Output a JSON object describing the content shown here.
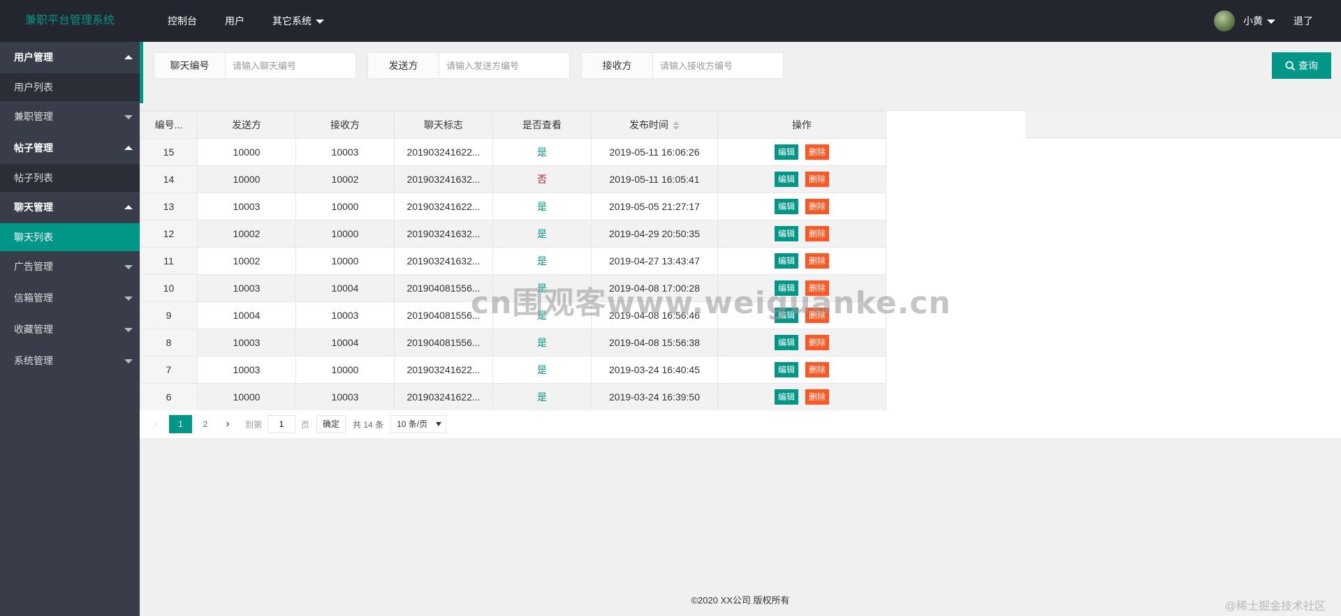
{
  "header": {
    "logo": "兼职平台管理系统",
    "nav": [
      "控制台",
      "用户",
      "其它系统"
    ],
    "user_name": "小黄",
    "logout": "退了"
  },
  "sidebar": {
    "groups": [
      {
        "label": "用户管理",
        "open": true,
        "subs": [
          "用户列表"
        ]
      },
      {
        "label": "兼职管理",
        "open": false,
        "subs": []
      },
      {
        "label": "帖子管理",
        "open": true,
        "subs": [
          "帖子列表"
        ]
      },
      {
        "label": "聊天管理",
        "open": true,
        "subs": [
          "聊天列表"
        ]
      },
      {
        "label": "广告管理",
        "open": false,
        "subs": []
      },
      {
        "label": "信箱管理",
        "open": false,
        "subs": []
      },
      {
        "label": "收藏管理",
        "open": false,
        "subs": []
      },
      {
        "label": "系统管理",
        "open": false,
        "subs": []
      }
    ],
    "active_sub": "聊天列表"
  },
  "search": {
    "chat_id_label": "聊天编号",
    "chat_id_placeholder": "请输入聊天编号",
    "sender_label": "发送方",
    "sender_placeholder": "请输入发送方编号",
    "receiver_label": "接收方",
    "receiver_placeholder": "请输入接收方编号",
    "query_button": "查询"
  },
  "table": {
    "columns": [
      "编号...",
      "发送方",
      "接收方",
      "聊天标志",
      "是否查看",
      "发布时间",
      "操作"
    ],
    "rows": [
      {
        "id": "15",
        "sender": "10000",
        "receiver": "10003",
        "flag": "201903241622...",
        "viewed": "是",
        "time": "2019-05-11 16:06:26"
      },
      {
        "id": "14",
        "sender": "10000",
        "receiver": "10002",
        "flag": "201903241632...",
        "viewed": "否",
        "time": "2019-05-11 16:05:41"
      },
      {
        "id": "13",
        "sender": "10003",
        "receiver": "10000",
        "flag": "201903241622...",
        "viewed": "是",
        "time": "2019-05-05 21:27:17"
      },
      {
        "id": "12",
        "sender": "10002",
        "receiver": "10000",
        "flag": "201903241632...",
        "viewed": "是",
        "time": "2019-04-29 20:50:35"
      },
      {
        "id": "11",
        "sender": "10002",
        "receiver": "10000",
        "flag": "201903241632...",
        "viewed": "是",
        "time": "2019-04-27 13:43:47"
      },
      {
        "id": "10",
        "sender": "10003",
        "receiver": "10004",
        "flag": "201904081556...",
        "viewed": "是",
        "time": "2019-04-08 17:00:28"
      },
      {
        "id": "9",
        "sender": "10004",
        "receiver": "10003",
        "flag": "201904081556...",
        "viewed": "是",
        "time": "2019-04-08 16:56:46"
      },
      {
        "id": "8",
        "sender": "10003",
        "receiver": "10004",
        "flag": "201904081556...",
        "viewed": "是",
        "time": "2019-04-08 15:56:38"
      },
      {
        "id": "7",
        "sender": "10003",
        "receiver": "10000",
        "flag": "201903241622...",
        "viewed": "是",
        "time": "2019-03-24 16:40:45"
      },
      {
        "id": "6",
        "sender": "10000",
        "receiver": "10003",
        "flag": "201903241622...",
        "viewed": "是",
        "time": "2019-03-24 16:39:50"
      }
    ],
    "edit_label": "编辑",
    "delete_label": "删除"
  },
  "pager": {
    "current": "1",
    "pages": [
      "1",
      "2"
    ],
    "goto_label": "到第",
    "goto_value": "1",
    "page_unit": "页",
    "confirm": "确定",
    "total": "共 14 条",
    "per_page": "10 条/页"
  },
  "footer": "©2020 XX公司 版权所有",
  "watermarks": {
    "center": "cn围观客www.weiguanke.cn",
    "corner": "@稀土掘金技术社区"
  },
  "colors": {
    "accent": "#009688",
    "danger": "#ff5722",
    "header_bg": "#23262e",
    "sidebar_bg": "#393d49",
    "no_color": "#c91a2e"
  }
}
